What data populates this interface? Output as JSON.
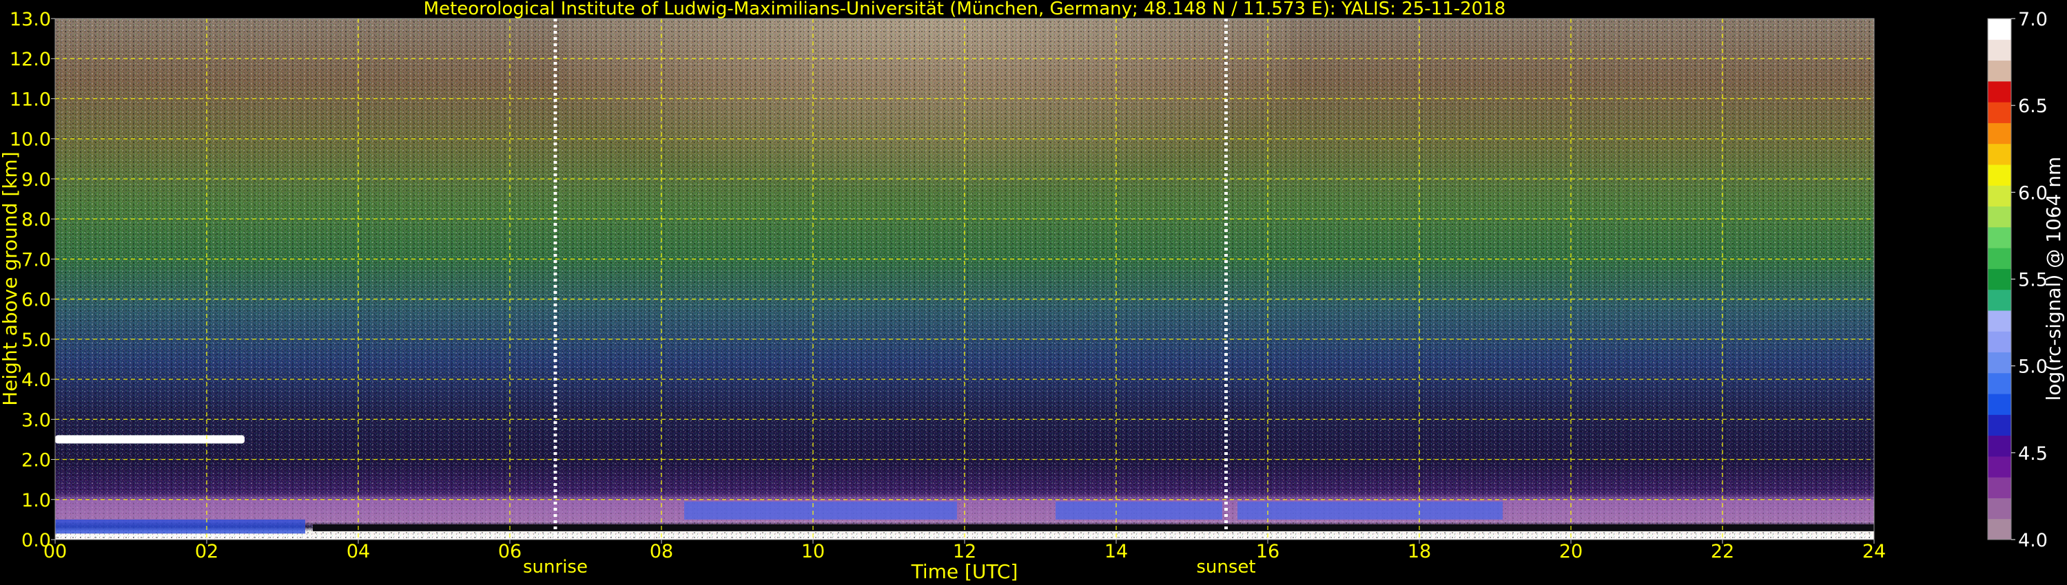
{
  "chart_data": {
    "type": "heatmap",
    "title": "Meteorological Institute of Ludwig-Maximilians-Universität (München, Germany; 48.148 N / 11.573 E):    YALIS: 25-11-2018",
    "xlabel": "Time [UTC]",
    "ylabel": "Height above ground [km]",
    "colorbar_label": "log(rc-signal) @ 1064 nm",
    "xlim": [
      0,
      24
    ],
    "ylim": [
      0,
      13
    ],
    "x_tick_labels": [
      "00",
      "02",
      "04",
      "06",
      "08",
      "10",
      "12",
      "14",
      "16",
      "18",
      "20",
      "22",
      "24"
    ],
    "y_tick_labels": [
      "0.0",
      "1.0",
      "2.0",
      "3.0",
      "4.0",
      "5.0",
      "6.0",
      "7.0",
      "8.0",
      "9.0",
      "10.0",
      "11.0",
      "12.0",
      "13.0"
    ],
    "clim": [
      4.0,
      7.0
    ],
    "colorbar_tick_labels": [
      "4.0",
      "4.5",
      "5.0",
      "5.5",
      "6.0",
      "6.5",
      "7.0"
    ],
    "grid": true,
    "markers": [
      {
        "label": "sunrise",
        "time": 6.6
      },
      {
        "label": "sunset",
        "time": 15.45
      }
    ],
    "features": [
      {
        "name": "elevated layer",
        "t_start": 0.0,
        "t_end": 2.5,
        "height_km": 2.5
      },
      {
        "name": "boundary layer",
        "t_start": 0.0,
        "t_end": 24.0,
        "height_km": 1.0
      }
    ]
  },
  "colors": {
    "text": "#ffff00",
    "grid": "#ffff00",
    "background": "#000000",
    "colormap": [
      "#a9899f",
      "#9a68a0",
      "#873c9c",
      "#6c169a",
      "#4e0c98",
      "#2027c2",
      "#1a54e8",
      "#3d74f0",
      "#6a8ff0",
      "#8f9ff5",
      "#a7b2f7",
      "#2bb27a",
      "#169b3c",
      "#3dbd52",
      "#66d466",
      "#a7e155",
      "#d2ea3c",
      "#f4f20a",
      "#f8c30b",
      "#f88d0d",
      "#ee4611",
      "#d70e0e",
      "#d7b8a5",
      "#f0e2dc",
      "#ffffff"
    ]
  }
}
